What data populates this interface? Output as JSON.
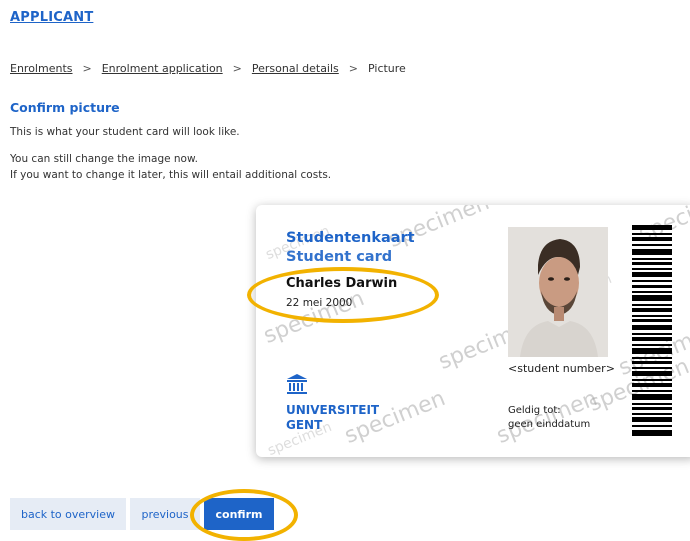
{
  "header": {
    "title": "APPLICANT"
  },
  "breadcrumb": {
    "items": [
      "Enrolments",
      "Enrolment application",
      "Personal details"
    ],
    "separator": ">",
    "current": "Picture"
  },
  "section": {
    "title": "Confirm picture",
    "text1": "This is what your student card will look like.",
    "text2": "You can still change the image now.",
    "text3": "If you want to change it later, this will entail additional costs."
  },
  "card": {
    "title_nl": "Studentenkaart",
    "title_en": "Student card",
    "name": "Charles Darwin",
    "dob": "22 mei 2000",
    "university_line1": "UNIVERSITEIT",
    "university_line2": "GENT",
    "student_number": "<student number>",
    "valid_label": "Geldig tot:",
    "valid_value": "geen einddatum",
    "watermark": "specimen"
  },
  "buttons": {
    "back": "back to overview",
    "previous": "previous",
    "confirm": "confirm"
  },
  "colors": {
    "accent": "#1e64c8",
    "highlight": "#f2b200",
    "button_bg": "#e6ecf5"
  }
}
